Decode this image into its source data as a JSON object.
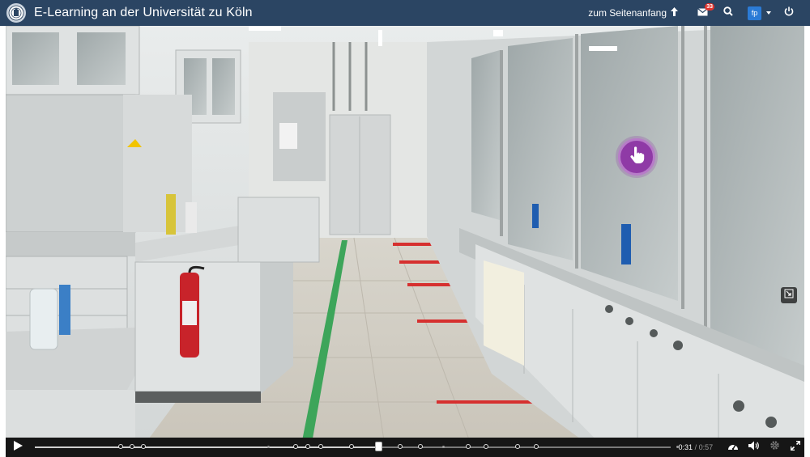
{
  "header": {
    "title": "E-Learning an der Universität zu Köln",
    "to_top_label": "zum Seitenanfang",
    "mail_badge": "33",
    "avatar_initials": "fp"
  },
  "player": {
    "time_current": "0:31",
    "time_separator": "/",
    "time_duration": "0:57",
    "progress": 0.54
  },
  "colors": {
    "header_bg": "#2b4563",
    "hotspot": "#8f3aa6",
    "badge": "#e0342e",
    "avatar": "#2b7bd6"
  }
}
